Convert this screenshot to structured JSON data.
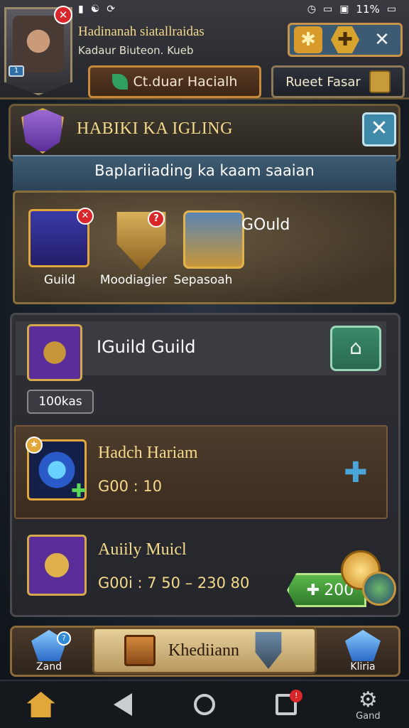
{
  "status_bar": {
    "left_icons": [
      "notification-icon",
      "wifi-icon",
      "sync-icon"
    ],
    "battery_text": "11%",
    "right_icons": [
      "alarm-icon",
      "signal-icon",
      "photo-icon",
      "battery-icon"
    ]
  },
  "header": {
    "player_name": "Hadinanah siatallraidas",
    "player_subtitle": "Kadaur Biuteon. Kueb",
    "avatar_badge": "1",
    "top_buttons": [
      "puzzle-icon",
      "plus-icon",
      "close-icon"
    ],
    "button_left_label": "Ct.duar Hacialh",
    "button_right_label": "Rueet Fasar"
  },
  "panel": {
    "title": "HABIKI KA IGLING",
    "subtitle": "Baplariiading ka kaam saaian",
    "items": [
      {
        "label": "Guild",
        "icon": "gem-mask-icon"
      },
      {
        "label": "Moodiagier",
        "icon": "golden-shield-icon"
      },
      {
        "label": "Sepasoah",
        "icon": "treasure-chest-icon"
      }
    ],
    "gold_label": "GOuld"
  },
  "guild": {
    "name": "IGuild Guild",
    "tag": "100kas"
  },
  "rows": [
    {
      "title": "Hadch Hariam",
      "value": "G00 : 10",
      "icon": "blue-gem-icon"
    },
    {
      "title": "Auiily Muicl",
      "value": "G00i : 7 50 – 230 80",
      "icon": "golden-armor-icon",
      "price": "200"
    }
  ],
  "bottom": {
    "left_label": "Zand",
    "main_label": "Khediiann",
    "right_label": "Kliria"
  },
  "nav": {
    "settings_label": "Gand",
    "badge": "!"
  }
}
